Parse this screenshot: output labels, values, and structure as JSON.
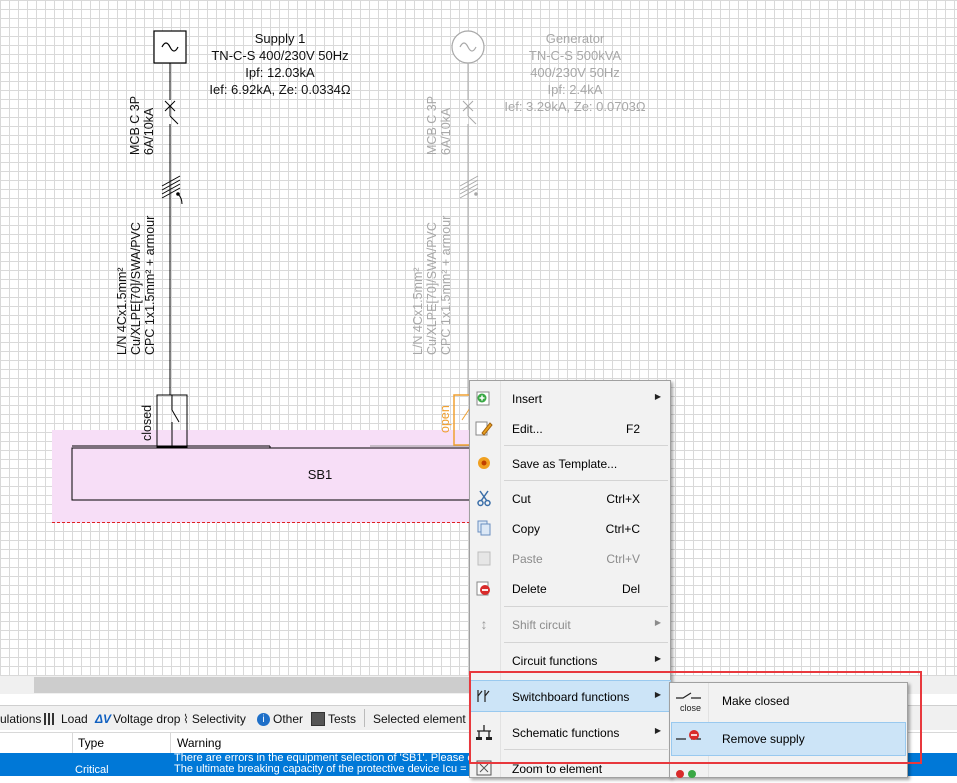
{
  "diagram": {
    "supply1": {
      "title": "Supply 1",
      "system": "TN-C-S 400/230V 50Hz",
      "ipf": "Ipf: 12.03kA",
      "ief": "Ief: 6.92kA, Ze: 0.0334Ω"
    },
    "generator": {
      "title": "Generator",
      "system": "TN-C-S 500kVA",
      "voltage": "400/230V 50Hz",
      "ipf": "Ipf: 2.4kA",
      "ief": "Ief: 3.29kA, Ze: 0.0703Ω"
    },
    "breaker1": {
      "line1": "MCB C 3P",
      "line2": "6A/10kA"
    },
    "breaker2": {
      "line1": "MCB C 3P",
      "line2": "6A/10kA"
    },
    "cable1": {
      "line1": "L/N 4Cx1.5mm²",
      "line2": "Cu/XLPE[70]/SWA/PVC",
      "line3": "CPC 1x1.5mm² + armour"
    },
    "cable2": {
      "line1": "L/N 4Cx1.5mm²",
      "line2": "Cu/XLPE[70]/SWA/PVC",
      "line3": "CPC 1x1.5mm² + armour"
    },
    "switch1_state": "closed",
    "switch2_state": "open",
    "switchboard": "SB1"
  },
  "context_menu": {
    "items": [
      {
        "label": "Insert",
        "shortcut": "",
        "submenu": true,
        "icon": "insert-icon"
      },
      {
        "label": "Edit...",
        "shortcut": "F2",
        "submenu": false,
        "icon": "edit-icon"
      },
      {
        "label": "Save as Template...",
        "shortcut": "",
        "submenu": false,
        "icon": "save-template-icon"
      },
      {
        "label": "Cut",
        "shortcut": "Ctrl+X",
        "submenu": false,
        "icon": "cut-icon"
      },
      {
        "label": "Copy",
        "shortcut": "Ctrl+C",
        "submenu": false,
        "icon": "copy-icon"
      },
      {
        "label": "Paste",
        "shortcut": "Ctrl+V",
        "submenu": false,
        "icon": "paste-icon"
      },
      {
        "label": "Delete",
        "shortcut": "Del",
        "submenu": false,
        "icon": "delete-icon"
      },
      {
        "label": "Shift circuit",
        "shortcut": "",
        "submenu": true,
        "icon": "shift-icon"
      },
      {
        "label": "Circuit functions",
        "shortcut": "",
        "submenu": true,
        "icon": ""
      },
      {
        "label": "Switchboard functions",
        "shortcut": "",
        "submenu": true,
        "icon": "switchboard-icon"
      },
      {
        "label": "Schematic functions",
        "shortcut": "",
        "submenu": true,
        "icon": "schematic-icon"
      },
      {
        "label": "Zoom to element",
        "shortcut": "",
        "submenu": false,
        "icon": "zoom-icon"
      }
    ]
  },
  "submenu": {
    "items": [
      {
        "label": "Make closed",
        "icon_text": "close"
      },
      {
        "label": "Remove supply",
        "icon_text": ""
      }
    ]
  },
  "tabs": {
    "calculations": "ulations",
    "load": "Load",
    "voltage_drop": "Voltage drop",
    "selectivity": "Selectivity",
    "other": "Other",
    "tests": "Tests",
    "selected_element": "Selected element on"
  },
  "grid": {
    "headers": {
      "type": "Type",
      "warning": "Warning"
    },
    "row": {
      "type": "Critical",
      "warning_line1": "There are errors in the equipment selection of 'SB1'. Please e",
      "warning_line2": "The ultimate breaking capacity of the protective device Icu ="
    }
  },
  "colors": {
    "highlight_box": "#e8383d",
    "selection": "#0078d7",
    "menu_hover": "#cce4f7",
    "switchboard_zone": "#f6dcf6",
    "selected_switch": "#f0a030"
  }
}
